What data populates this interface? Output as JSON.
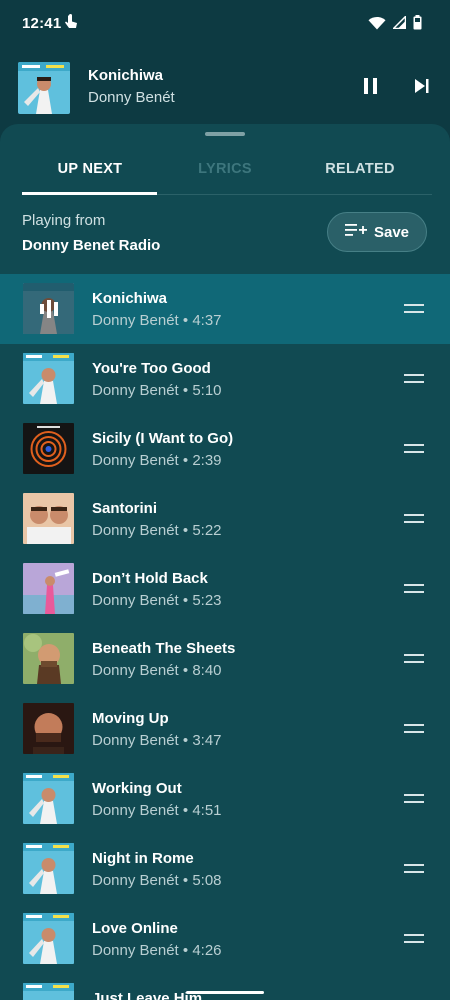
{
  "status": {
    "time": "12:41"
  },
  "now_playing": {
    "title": "Konichiwa",
    "artist": "Donny Benét"
  },
  "tabs": [
    {
      "label": "UP NEXT",
      "active": true
    },
    {
      "label": "LYRICS",
      "active": false
    },
    {
      "label": "RELATED",
      "active": false
    }
  ],
  "queue_header": {
    "playing_from_label": "Playing from",
    "source": "Donny Benet Radio",
    "save_label": "Save"
  },
  "queue": [
    {
      "title": "Konichiwa",
      "meta": "Donny Benét • 4:37",
      "art": "album-blue",
      "current": true
    },
    {
      "title": "You're Too Good",
      "meta": "Donny Benét • 5:10",
      "art": "album-blue"
    },
    {
      "title": "Sicily (I Want to Go)",
      "meta": "Donny Benét • 2:39",
      "art": "album-circle"
    },
    {
      "title": "Santorini",
      "meta": "Donny Benét • 5:22",
      "art": "album-duo"
    },
    {
      "title": "Don’t Hold Back",
      "meta": "Donny Benét • 5:23",
      "art": "album-pink"
    },
    {
      "title": "Beneath The Sheets",
      "meta": "Donny Benét • 8:40",
      "art": "album-portrait"
    },
    {
      "title": "Moving Up",
      "meta": "Donny Benét • 3:47",
      "art": "album-dark"
    },
    {
      "title": "Working Out",
      "meta": "Donny Benét • 4:51",
      "art": "album-blue"
    },
    {
      "title": "Night in Rome",
      "meta": "Donny Benét • 5:08",
      "art": "album-blue"
    },
    {
      "title": "Love Online",
      "meta": "Donny Benét • 4:26",
      "art": "album-blue"
    },
    {
      "title": "Just Leave Him",
      "meta": "",
      "art": "album-blue"
    }
  ],
  "colors": {
    "background": "#0d3a42",
    "sheet": "#114a52",
    "current_row": "#106877",
    "accent": "#ffffff"
  }
}
